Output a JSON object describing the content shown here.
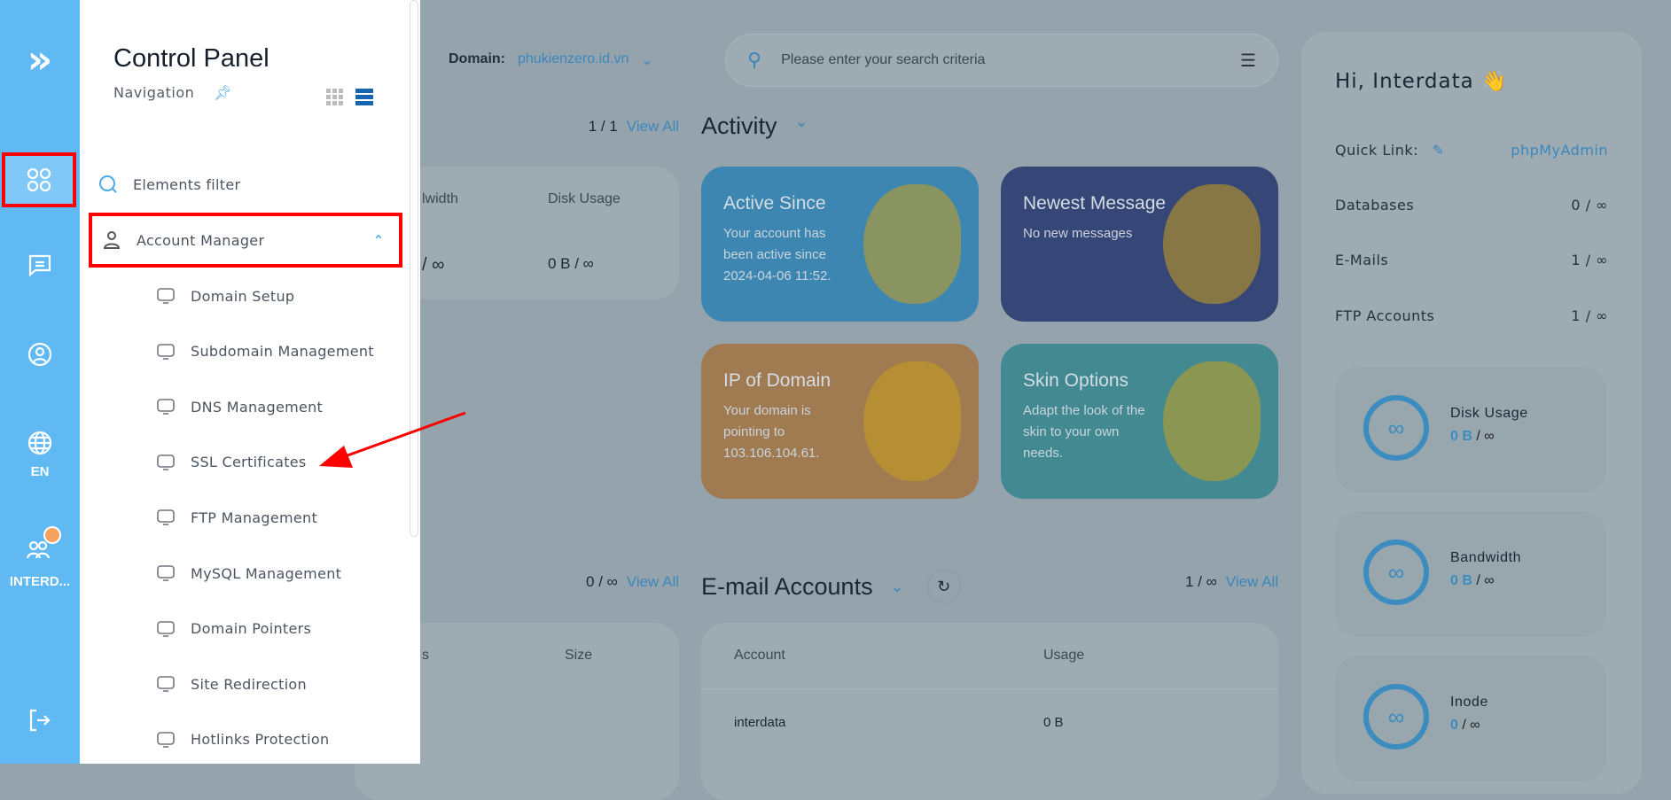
{
  "rail": {
    "lang": "EN",
    "user": "INTERD...",
    "accent": "#61b9f4",
    "badge_color": "#f5a25d"
  },
  "drawer": {
    "title": "Control Panel",
    "subtitle": "Navigation",
    "filter": "Elements filter",
    "section": "Account Manager",
    "items": [
      {
        "label": "Domain Setup",
        "icon": "www-globe-icon"
      },
      {
        "label": "Subdomain Management",
        "icon": "monitor-icon"
      },
      {
        "label": "DNS Management",
        "icon": "dns-globe-icon"
      },
      {
        "label": "SSL Certificates",
        "icon": "ssl-badge-icon"
      },
      {
        "label": "FTP Management",
        "icon": "ftp-folder-icon"
      },
      {
        "label": "MySQL Management",
        "icon": "sql-monitor-icon"
      },
      {
        "label": "Domain Pointers",
        "icon": "monitor-icon"
      },
      {
        "label": "Site Redirection",
        "icon": "signpost-icon"
      },
      {
        "label": "Hotlinks Protection",
        "icon": "lock-icon"
      }
    ]
  },
  "header": {
    "domain_label": "Domain:",
    "domain": "phukienzero.id.vn",
    "search_placeholder": "Please enter your search criteria"
  },
  "left_top": {
    "count": "1 / 1",
    "view_all": "View All",
    "col1": "lwidth",
    "col2": "Disk Usage",
    "val1": "/ ∞",
    "val2": "0 B / ∞"
  },
  "activity": {
    "title": "Activity",
    "cards": [
      {
        "title": "Active Since",
        "text": "Your account has been active since 2024-04-06 11:52.",
        "color": "#3d86b1"
      },
      {
        "title": "Newest Message",
        "text": "No new messages",
        "color": "#364677"
      },
      {
        "title": "IP of Domain",
        "text": "Your domain is pointing to 103.106.104.61.",
        "color": "#a07a51"
      },
      {
        "title": "Skin Options",
        "text": "Adapt the look of the skin to your own needs.",
        "color": "#428992"
      }
    ]
  },
  "left_bottom": {
    "count": "0 / ∞",
    "view_all": "View All",
    "col1": "s",
    "col2": "Size"
  },
  "email": {
    "title": "E-mail Accounts",
    "count": "1 / ∞",
    "view_all": "View All",
    "col_account": "Account",
    "col_usage": "Usage",
    "rows": [
      {
        "account": "interdata",
        "usage": "0 B"
      }
    ]
  },
  "right": {
    "greeting": "Hi, Interdata 👋",
    "quick_link_label": "Quick Link:",
    "quick_link": "phpMyAdmin",
    "rows": [
      {
        "label": "Databases",
        "value": "0 / ∞"
      },
      {
        "label": "E-Mails",
        "value": "1 / ∞"
      },
      {
        "label": "FTP Accounts",
        "value": "1 / ∞"
      }
    ],
    "stats": [
      {
        "name": "Disk Usage",
        "used": "0 B",
        "limit": "/ ∞"
      },
      {
        "name": "Bandwidth",
        "used": "0 B",
        "limit": "/ ∞"
      },
      {
        "name": "Inode",
        "used": "0",
        "limit": "/ ∞"
      }
    ]
  }
}
